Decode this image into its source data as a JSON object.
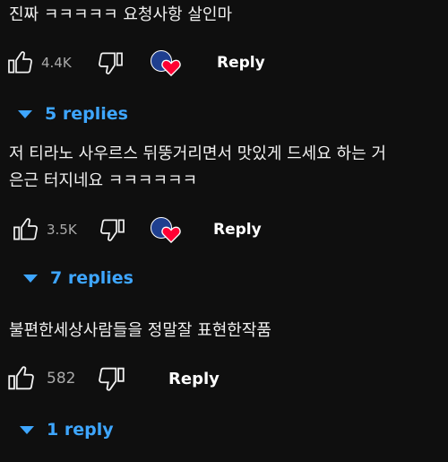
{
  "comments": [
    {
      "text": "진짜 ㅋㅋㅋㅋㅋ 요청사항 살인마",
      "likes": "4.4K",
      "reply_label": "Reply",
      "creator_hearted": true,
      "replies_label": "5 replies"
    },
    {
      "text": "저 티라노 사우르스 뒤뚱거리면서 맛있게 드세요 하는 거\n은근 터지네요 ㅋㅋㅋㅋㅋㅋ",
      "likes": "3.5K",
      "reply_label": "Reply",
      "creator_hearted": true,
      "replies_label": "7 replies"
    },
    {
      "text": "불편한세상사람들을 정말잘 표현한작품",
      "likes": "582",
      "reply_label": "Reply",
      "creator_hearted": false,
      "replies_label": "1 reply"
    }
  ],
  "icons": {
    "like": "thumbs-up-icon",
    "dislike": "thumbs-down-icon",
    "heart": "creator-heart-icon",
    "expand": "caret-down-icon"
  },
  "colors": {
    "background": "#0f0f0f",
    "text": "#f1f1f1",
    "muted": "#aaaaaa",
    "link": "#3ea6ff",
    "heart": "#ff0033",
    "avatar": "#1f3f8f"
  }
}
